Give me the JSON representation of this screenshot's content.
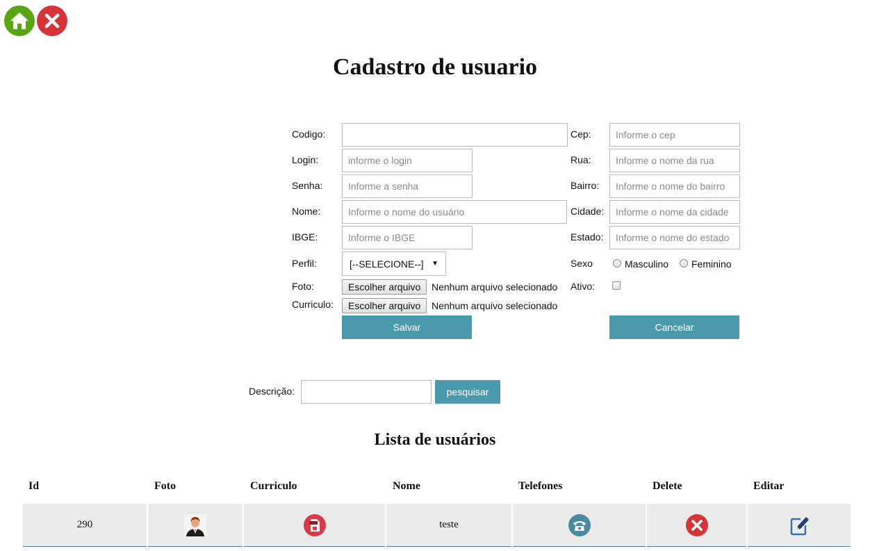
{
  "nav": {
    "home_icon": "home-icon",
    "close_icon": "close-icon"
  },
  "page_title": "Cadastro de usuario",
  "form": {
    "codigo": {
      "label": "Codigo:",
      "value": "",
      "placeholder": ""
    },
    "login": {
      "label": "Login:",
      "placeholder": "informe o login"
    },
    "senha": {
      "label": "Senha:",
      "placeholder": "Informe a senha"
    },
    "nome": {
      "label": "Nome:",
      "placeholder": "Informe o nome do usuário"
    },
    "ibge": {
      "label": "IBGE:",
      "placeholder": "Informe o IBGE"
    },
    "perfil": {
      "label": "Perfil:",
      "selected": "[--SELECIONE--]"
    },
    "foto": {
      "label": "Foto:",
      "button": "Escolher arquivo",
      "status": "Nenhum arquivo selecionado"
    },
    "curriculo": {
      "label": "Curriculo:",
      "button": "Escolher arquivo",
      "status": "Nenhum arquivo selecionado"
    },
    "cep": {
      "label": "Cep:",
      "placeholder": "Informe o cep"
    },
    "rua": {
      "label": "Rua:",
      "placeholder": "Informe o nome da rua"
    },
    "bairro": {
      "label": "Bairro:",
      "placeholder": "Informe o nome do bairro"
    },
    "cidade": {
      "label": "Cidade:",
      "placeholder": "Informe o nome da cidade"
    },
    "estado": {
      "label": "Estado:",
      "placeholder": "Informe o nome do estado"
    },
    "sexo": {
      "label": "Sexo",
      "options": [
        "Masculino",
        "Feminino"
      ]
    },
    "ativo": {
      "label": "Ativo:",
      "checked": false
    },
    "save_label": "Salvar",
    "cancel_label": "Cancelar"
  },
  "search": {
    "label": "Descrição:",
    "value": "",
    "button": "pesquisar"
  },
  "list_title": "Lista de usuários",
  "table": {
    "columns": [
      "Id",
      "Foto",
      "Curriculo",
      "Nome",
      "Telefones",
      "Delete",
      "Editar"
    ],
    "rows": [
      {
        "id": "290",
        "foto_icon": "user-avatar-icon",
        "curriculo_icon": "pdf-icon",
        "nome": "teste",
        "telefones_icon": "phone-icon",
        "delete_icon": "delete-icon",
        "edit_icon": "edit-icon"
      }
    ]
  },
  "colors": {
    "accent": "#4b9aab",
    "home_green": "#5aa516",
    "close_red": "#d3353b",
    "row_bg": "#ebebeb"
  }
}
